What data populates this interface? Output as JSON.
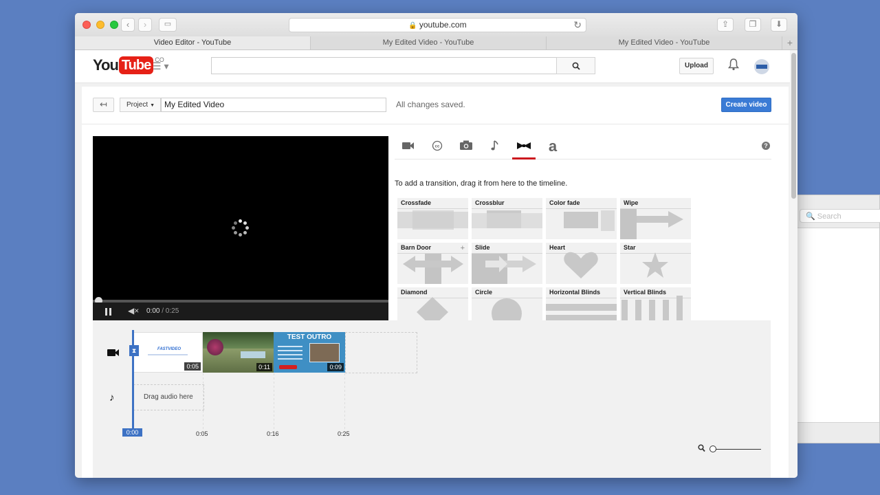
{
  "browser": {
    "url": "youtube.com",
    "tabs": [
      {
        "label": "Video Editor - YouTube",
        "active": true
      },
      {
        "label": "My Edited Video - YouTube",
        "active": false
      },
      {
        "label": "My Edited Video - YouTube",
        "active": false
      }
    ],
    "new_tab": "+"
  },
  "yt_header": {
    "logo_you": "You",
    "logo_tube": "Tube",
    "logo_country": "CO",
    "search_placeholder": "",
    "upload_label": "Upload"
  },
  "editor": {
    "project_label": "Project",
    "title_value": "My Edited Video",
    "save_status": "All changes saved.",
    "create_label": "Create video"
  },
  "player": {
    "current_time": "0:00",
    "duration": "/ 0:25",
    "progress": 0
  },
  "tools": {
    "active": "transitions",
    "help": "?",
    "hint": "To add a transition, drag it from here to the timeline.",
    "transitions": [
      "Crossfade",
      "Crossblur",
      "Color fade",
      "Wipe",
      "Barn Door",
      "Slide",
      "Heart",
      "Star",
      "Diamond",
      "Circle",
      "Horizontal Blinds",
      "Vertical Blinds"
    ]
  },
  "timeline": {
    "clips": [
      {
        "brand": "FASTVIDEO",
        "duration": "0:05"
      },
      {
        "duration": "0:11"
      },
      {
        "title": "TEST OUTRO",
        "duration": "0:09"
      }
    ],
    "audio_placeholder": "Drag audio here",
    "playhead_time": "0:00",
    "ticks": [
      "0:05",
      "0:16",
      "0:25"
    ]
  },
  "colors": {
    "desktop": "#5b7fc1",
    "accent_blue": "#3a7bd5",
    "youtube_red": "#e62117",
    "active_tab_underline": "#cc181e",
    "playhead": "#3d72c4"
  },
  "icons": {
    "back": "arrow-left-icon",
    "search": "magnifier-icon",
    "bell": "bell-icon",
    "tools": [
      "video-camera-icon",
      "cc-icon",
      "camera-icon",
      "music-note-icon",
      "bowtie-icon",
      "text-a-icon"
    ]
  }
}
